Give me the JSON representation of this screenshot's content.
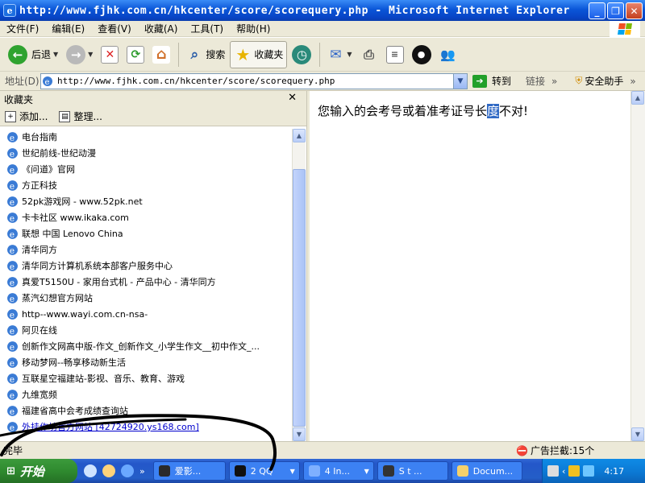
{
  "window": {
    "title": "http://www.fjhk.com.cn/hkcenter/score/scorequery.php - Microsoft Internet Explorer",
    "minimize_icon": "minimize-icon",
    "restore_icon": "restore-icon",
    "close_icon": "close-icon"
  },
  "menubar": {
    "items": [
      "文件(F)",
      "编辑(E)",
      "查看(V)",
      "收藏(A)",
      "工具(T)",
      "帮助(H)"
    ]
  },
  "toolbar": {
    "back_label": "后退",
    "search_label": "搜索",
    "favorites_label": "收藏夹"
  },
  "addressbar": {
    "label": "地址(D)",
    "url": "http://www.fjhk.com.cn/hkcenter/score/scorequery.php",
    "go_label": "转到",
    "links_label": "链接",
    "helper_label": "安全助手"
  },
  "favorites": {
    "header": "收藏夹",
    "add_label": "添加...",
    "organize_label": "整理...",
    "items": [
      "电台指南",
      "世纪前线-世纪动漫",
      "《问道》官网",
      "方正科技",
      "52pk游戏网 - www.52pk.net",
      "卡卡社区 www.ikaka.com",
      "联想 中国 Lenovo China",
      "清华同方",
      "清华同方计算机系统本部客户服务中心",
      "真爱T5150U - 家用台式机 - 产品中心 - 清华同方",
      "蒸汽幻想官方网站",
      "http--www.wayi.com.cn-nsa-",
      "阿贝在线",
      "创新作文网高中版-作文_创新作文_小学生作文__初中作文_...",
      "移动梦网--畅享移动新生活",
      "互联星空福建站-影视、音乐、教育、游戏",
      "九维宽频",
      "福建省高中会考成绩查询站",
      "外挂作坊官方网站 [42724920.ys168.com]"
    ]
  },
  "content": {
    "message_before": "您输入的会考号或着准考证号长",
    "message_highlight": "度",
    "message_after": "不对!"
  },
  "statusbar": {
    "left": "完毕",
    "blocker": "广告拦截:15个"
  },
  "taskbar": {
    "start_label": "开始",
    "tasks": [
      "爱影...",
      "2 QQ",
      "4 In...",
      "S t ...",
      "Docum..."
    ],
    "clock": "4:17"
  },
  "colors": {
    "titlebar": "#0a56d8",
    "chrome": "#ece9d8",
    "highlight": "#316ac5",
    "taskbar": "#245ec8",
    "start": "#2f8a2f"
  }
}
